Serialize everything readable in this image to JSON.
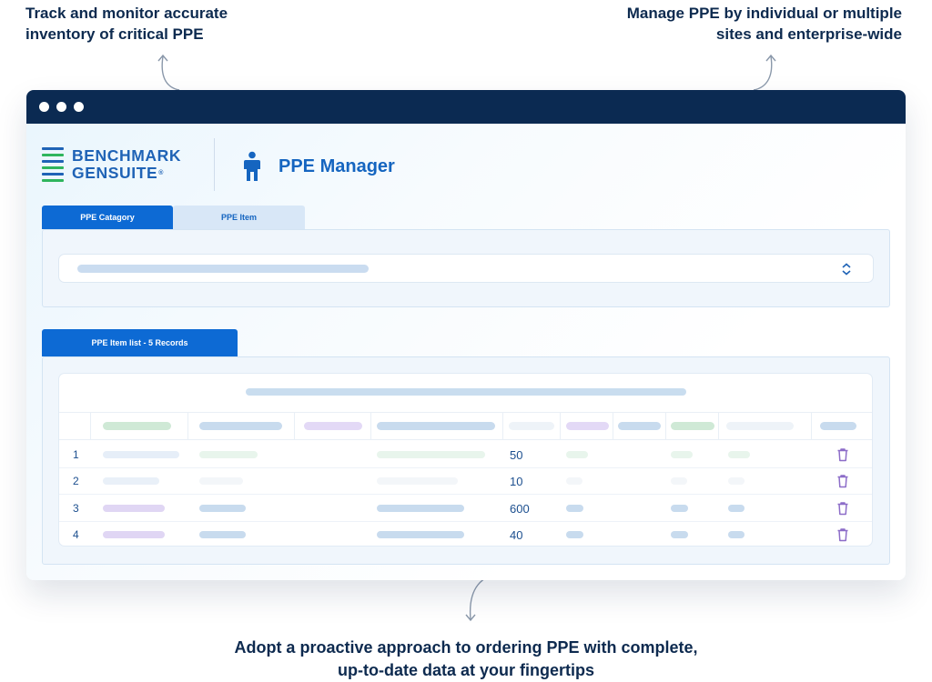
{
  "callouts": {
    "left_line1": "Track and monitor accurate",
    "left_line2": "inventory of critical PPE",
    "right_line1": "Manage PPE by individual or multiple",
    "right_line2": "sites and enterprise-wide",
    "bottom_line1": "Adopt a proactive approach to ordering PPE with complete,",
    "bottom_line2": "up-to-date data at your fingertips"
  },
  "brand": {
    "line1": "BENCHMARK",
    "line2": "GENSUITE",
    "registered": "®",
    "logo_colors": [
      "#1f63b6",
      "#2fb55d",
      "#1f63b6",
      "#2fb55d",
      "#1f63b6",
      "#2fb55d"
    ]
  },
  "app": {
    "title": "PPE Manager",
    "icon": "person-icon"
  },
  "tabs": [
    {
      "label": "PPE Catagory",
      "active": true
    },
    {
      "label": "PPE Item",
      "active": false
    }
  ],
  "list_tab": {
    "label": "PPE Item list - 5 Records"
  },
  "table": {
    "rows": [
      {
        "num": "1",
        "qty": "50"
      },
      {
        "num": "2",
        "qty": "10"
      },
      {
        "num": "3",
        "qty": "600"
      },
      {
        "num": "4",
        "qty": "40"
      }
    ],
    "row_action_icon": "trash-icon"
  },
  "colors": {
    "titlebar": "#0b2a52",
    "accent": "#0d6ad4",
    "text": "#0d2a4f"
  }
}
